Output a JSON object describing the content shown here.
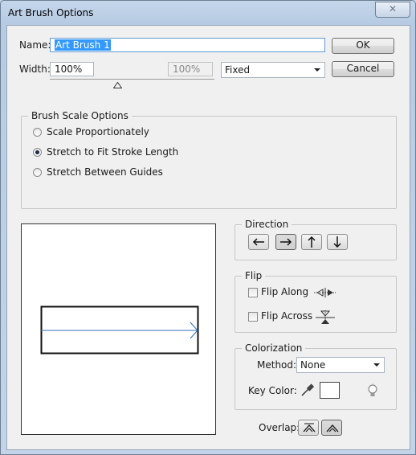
{
  "window": {
    "title": "Art Brush Options",
    "close_label": "✕"
  },
  "name_row": {
    "label": "Name:",
    "value": "Art Brush 1"
  },
  "width_row": {
    "label": "Width:",
    "value": "100%",
    "disabled_value": "100%",
    "mode": "Fixed"
  },
  "buttons": {
    "ok": "OK",
    "cancel": "Cancel"
  },
  "brush_scale": {
    "legend": "Brush Scale Options",
    "options": [
      "Scale Proportionately",
      "Stretch to Fit Stroke Length",
      "Stretch Between Guides"
    ],
    "selected": "Stretch to Fit Stroke Length"
  },
  "direction": {
    "legend": "Direction",
    "selected": "right",
    "icons": [
      "arrow-left-icon",
      "arrow-right-icon",
      "arrow-up-icon",
      "arrow-down-icon"
    ]
  },
  "flip": {
    "legend": "Flip",
    "along_label": "Flip Along",
    "across_label": "Flip Across",
    "along_checked": false,
    "across_checked": false
  },
  "colorization": {
    "legend": "Colorization",
    "method_label": "Method:",
    "method_value": "None",
    "key_color_label": "Key Color:",
    "key_color": "#ffffff"
  },
  "overlap": {
    "label": "Overlap:"
  },
  "colors": {
    "selection": "#3399ff",
    "stroke_line": "#2f6fb8",
    "window_frame": "#c5d6ea",
    "client_bg": "#f0f0f0"
  }
}
